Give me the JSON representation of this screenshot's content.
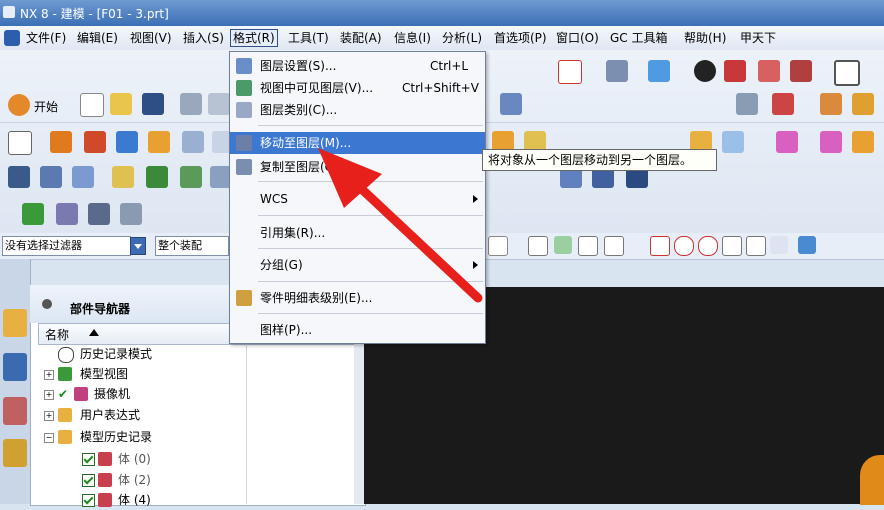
{
  "title": "NX 8 - 建模 - [F01 - 3.prt]",
  "menubar": {
    "items": [
      {
        "label": "文件(F)"
      },
      {
        "label": "编辑(E)"
      },
      {
        "label": "视图(V)"
      },
      {
        "label": "插入(S)"
      },
      {
        "label": "格式(R)"
      },
      {
        "label": "工具(T)"
      },
      {
        "label": "装配(A)"
      },
      {
        "label": "信息(I)"
      },
      {
        "label": "分析(L)"
      },
      {
        "label": "首选项(P)"
      },
      {
        "label": "窗口(O)"
      },
      {
        "label": "GC 工具箱"
      },
      {
        "label": "帮助(H)"
      },
      {
        "label": "甲天下"
      }
    ]
  },
  "toolbar": {
    "start_label": "开始"
  },
  "filter": {
    "type_filter": "没有选择过滤器",
    "scope": "整个装配"
  },
  "dropdown": {
    "items": [
      {
        "label": "图层设置(S)...",
        "shortcut": "Ctrl+L"
      },
      {
        "label": "视图中可见图层(V)...",
        "shortcut": "Ctrl+Shift+V"
      },
      {
        "label": "图层类别(C)...",
        "shortcut": ""
      },
      {
        "label": "移动至图层(M)...",
        "shortcut": ""
      },
      {
        "label": "复制至图层(O)...",
        "shortcut": ""
      },
      {
        "label": "WCS",
        "shortcut": ""
      },
      {
        "label": "引用集(R)...",
        "shortcut": ""
      },
      {
        "label": "分组(G)",
        "shortcut": ""
      },
      {
        "label": "零件明细表级别(E)...",
        "shortcut": ""
      },
      {
        "label": "图样(P)...",
        "shortcut": ""
      }
    ]
  },
  "tooltip": {
    "text": "将对象从一个图层移动到另一个图层。"
  },
  "navigator": {
    "title": "部件导航器",
    "column_name": "名称",
    "tree": [
      {
        "label": "历史记录模式"
      },
      {
        "label": "模型视图"
      },
      {
        "label": "摄像机"
      },
      {
        "label": "用户表达式"
      },
      {
        "label": "模型历史记录"
      },
      {
        "label": "体 (0)"
      },
      {
        "label": "体 (2)"
      },
      {
        "label": "体 (4)"
      }
    ]
  },
  "colors": {
    "menu_highlight": "#3c77d2",
    "arrow": "#e8201c",
    "graphics_bg": "#1a1a1a"
  }
}
